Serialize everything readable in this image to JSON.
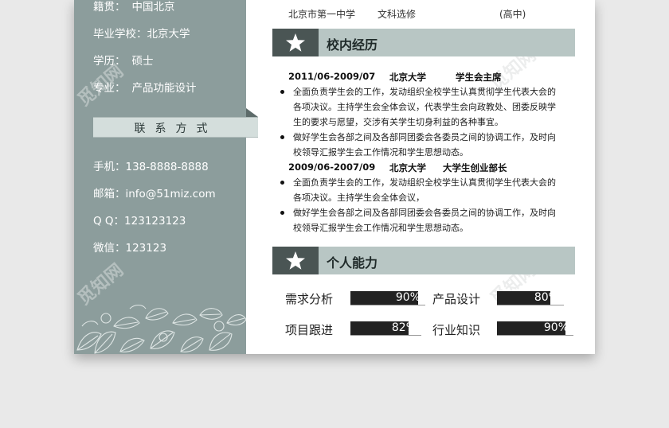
{
  "sidebar": {
    "info": [
      {
        "key": "籍贯：",
        "value": "中国北京"
      },
      {
        "key": "毕业学校：",
        "value": "北京大学"
      },
      {
        "key": "学历：",
        "value": "硕士"
      },
      {
        "key": "专业：",
        "value": "产品功能设计"
      }
    ],
    "contact_title": "联系方式",
    "contacts": [
      {
        "key": "手机：",
        "value": "138-8888-8888"
      },
      {
        "key": "邮箱：",
        "value": "info@51miz.com"
      },
      {
        "key": "Q Q：",
        "value": "123123123"
      },
      {
        "key": "微信：",
        "value": "123123"
      }
    ]
  },
  "education_tail": {
    "school": "北京市第一中学",
    "course": "文科选修",
    "level": "(高中)"
  },
  "campus": {
    "title": "校内经历",
    "items": [
      {
        "period": "2011/06-2009/07",
        "org": "北京大学",
        "role": "学生会主席",
        "bullets": [
          "全面负责学生会的工作，发动组织全校学生认真贯彻学生代表大会的各项决议。主持学生会全体会议，代表学生会向政教处、团委反映学生的要求与愿望，交涉有关学生切身利益的各种事宜。",
          "做好学生会各部之间及各部同团委会各委员之间的协调工作，及时向校领导汇报学生会工作情况和学生思想动态。"
        ]
      },
      {
        "period": "2009/06-2007/09",
        "org": "北京大学",
        "role": "大学生创业部长",
        "bullets": [
          "全面负责学生会的工作，发动组织全校学生认真贯彻学生代表大会的各项决议。主持学生会全体会议，",
          "做好学生会各部之间及各部同团委会各委员之间的协调工作，及时向校领导汇报学生会工作情况和学生思想动态。"
        ]
      }
    ]
  },
  "skills": {
    "title": "个人能力",
    "items": [
      {
        "name": "需求分析",
        "percent": 90,
        "label": "90%"
      },
      {
        "name": "产品设计",
        "percent": 80,
        "label": "80%"
      },
      {
        "name": "项目跟进",
        "percent": 82,
        "label": "82%"
      },
      {
        "name": "行业知识",
        "percent": 90,
        "label": "90%"
      }
    ]
  },
  "watermark": "觅知网",
  "colors": {
    "sidebar": "#8c9d9c",
    "header_band": "#b8c6c4",
    "star_box": "#4a5554",
    "skill_fill": "#222222"
  },
  "icons": [
    "star-icon",
    "leaf-pattern"
  ]
}
